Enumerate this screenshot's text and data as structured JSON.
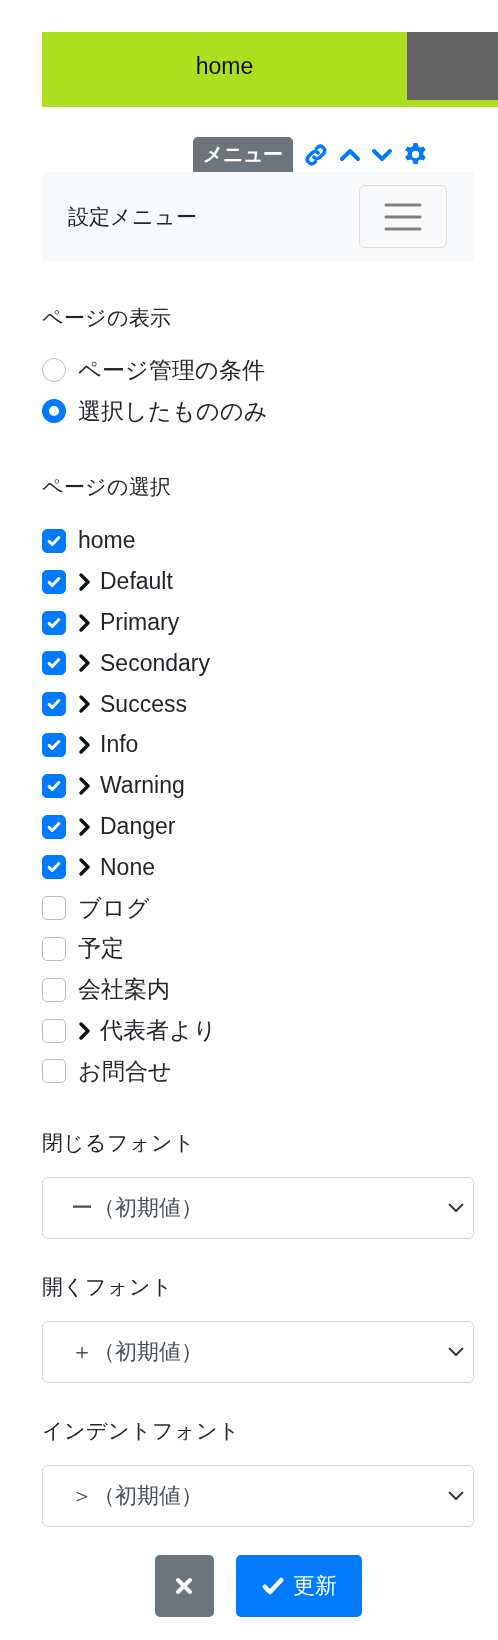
{
  "header": {
    "title": "home"
  },
  "toolbar": {
    "badge": "メニュー"
  },
  "navbar": {
    "title": "設定メニュー"
  },
  "display": {
    "label": "ページの表示",
    "options": [
      {
        "label": "ページ管理の条件",
        "selected": false
      },
      {
        "label": "選択したもののみ",
        "selected": true
      }
    ]
  },
  "pages": {
    "label": "ページの選択",
    "items": [
      {
        "label": "home",
        "checked": true,
        "expandable": false
      },
      {
        "label": "Default",
        "checked": true,
        "expandable": true
      },
      {
        "label": "Primary",
        "checked": true,
        "expandable": true
      },
      {
        "label": "Secondary",
        "checked": true,
        "expandable": true
      },
      {
        "label": "Success",
        "checked": true,
        "expandable": true
      },
      {
        "label": "Info",
        "checked": true,
        "expandable": true
      },
      {
        "label": "Warning",
        "checked": true,
        "expandable": true
      },
      {
        "label": "Danger",
        "checked": true,
        "expandable": true
      },
      {
        "label": "None",
        "checked": true,
        "expandable": true
      },
      {
        "label": "ブログ",
        "checked": false,
        "expandable": false
      },
      {
        "label": "予定",
        "checked": false,
        "expandable": false
      },
      {
        "label": "会社案内",
        "checked": false,
        "expandable": false
      },
      {
        "label": "代表者より",
        "checked": false,
        "expandable": true
      },
      {
        "label": "お問合せ",
        "checked": false,
        "expandable": false
      }
    ]
  },
  "fonts": [
    {
      "label": "閉じるフォント",
      "value": "ー（初期値）"
    },
    {
      "label": "開くフォント",
      "value": "＋（初期値）"
    },
    {
      "label": "インデントフォント",
      "value": "＞（初期値）"
    }
  ],
  "buttons": {
    "update": "更新"
  }
}
